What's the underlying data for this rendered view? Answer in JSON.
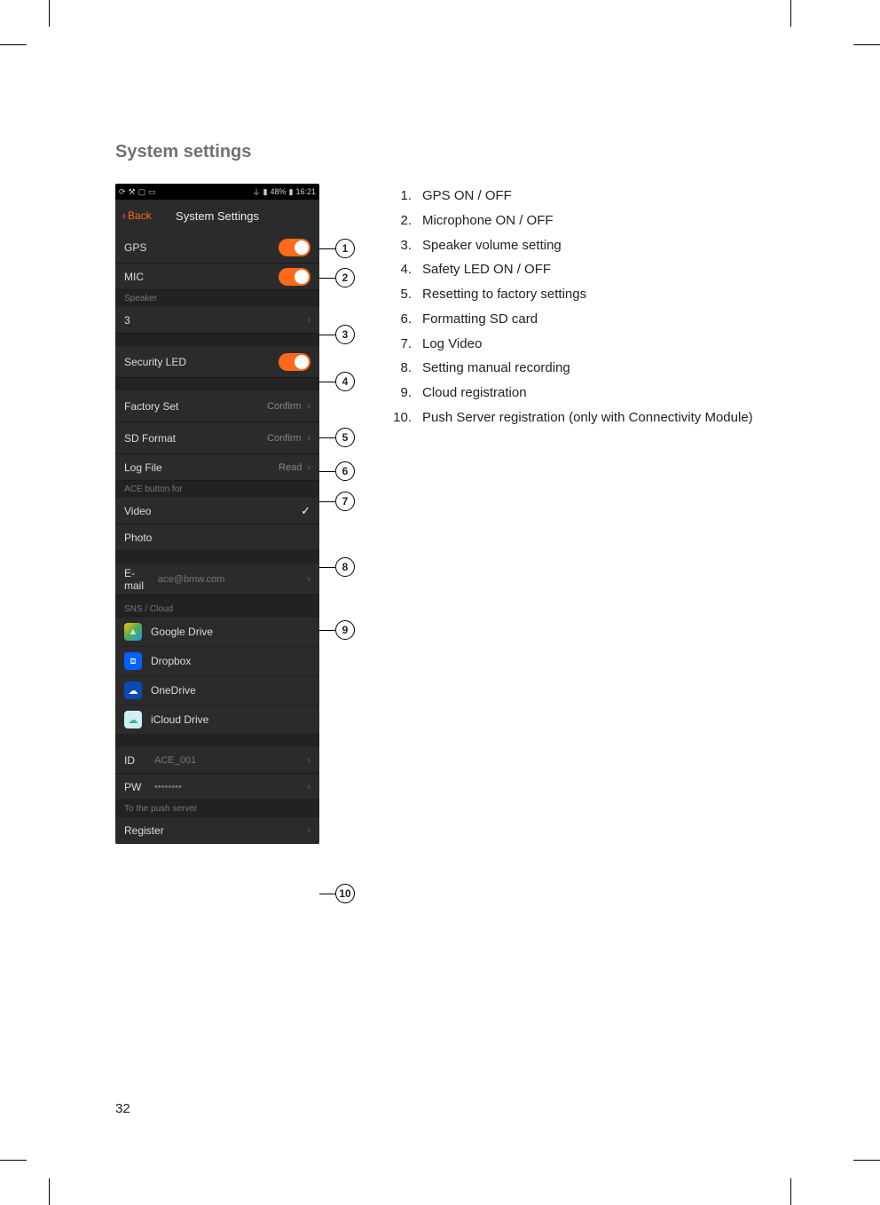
{
  "heading": "System settings",
  "page_number": "32",
  "statusbar": {
    "battery": "48%",
    "time": "16:21"
  },
  "nav": {
    "back": "Back",
    "title": "System Settings"
  },
  "rows": {
    "gps": "GPS",
    "mic": "MIC",
    "speaker_hdr": "Speaker",
    "speaker_val": "3",
    "security_led": "Security LED",
    "factory_set": "Factory Set",
    "confirm": "Confirm",
    "sd_format": "SD Format",
    "log_file": "Log File",
    "read": "Read",
    "ace_button": "ACE button for",
    "video": "Video",
    "photo": "Photo",
    "email_label": "E-mail",
    "email_value": "ace@bmw.com",
    "sns_cloud": "SNS / Cloud",
    "gd": "Google Drive",
    "db": "Dropbox",
    "od": "OneDrive",
    "ic": "iCloud Drive",
    "id_label": "ID",
    "id_value": "ACE_001",
    "pw_label": "PW",
    "pw_value": "••••••••",
    "push_hdr": "To the push server",
    "register": "Register"
  },
  "legend": {
    "1": "GPS ON / OFF",
    "2": "Microphone ON / OFF",
    "3": "Speaker volume setting",
    "4": "Safety LED ON / OFF",
    "5": "Resetting to factory settings",
    "6": "Formatting SD card",
    "7": "Log Video",
    "8": "Setting manual recording",
    "9": "Cloud registration",
    "10": "Push Server registration (only with Connectivity Module)"
  },
  "callouts": [
    "1",
    "2",
    "3",
    "4",
    "5",
    "6",
    "7",
    "8",
    "9",
    "10"
  ]
}
